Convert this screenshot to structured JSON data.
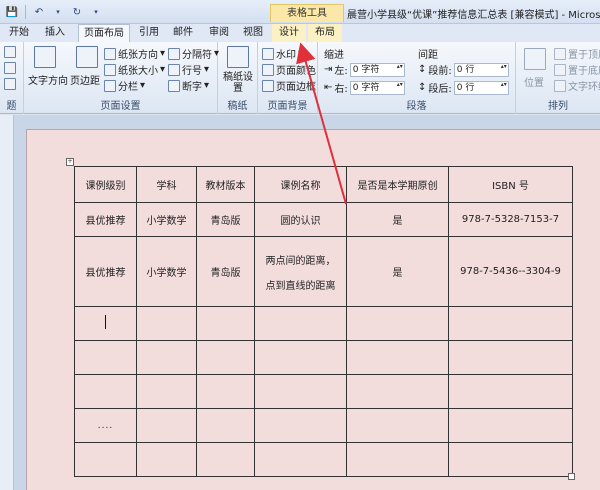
{
  "title_bar": {
    "context_tab_group": "表格工具",
    "document_title": "晨营小学县级“优课”推荐信息汇总表 [兼容模式] - Micros..."
  },
  "tabs": [
    {
      "label": "开始"
    },
    {
      "label": "插入"
    },
    {
      "label": "页面布局"
    },
    {
      "label": "引用"
    },
    {
      "label": "邮件"
    },
    {
      "label": "审阅"
    },
    {
      "label": "视图"
    },
    {
      "label": "设计"
    },
    {
      "label": "布局"
    }
  ],
  "ribbon": {
    "partial_group_label": "题",
    "page_setup": {
      "text_direction": "文字方向",
      "margins": "页边距",
      "orientation": "纸张方向",
      "size": "纸张大小",
      "columns": "分栏",
      "breaks": "分隔符",
      "line_numbers": "行号",
      "hyphenation": "断字",
      "label": "页面设置"
    },
    "manuscript": {
      "button": "稿纸设置",
      "label": "稿纸"
    },
    "page_background": {
      "watermark": "水印",
      "page_color": "页面颜色",
      "page_borders": "页面边框",
      "label": "页面背景"
    },
    "paragraph": {
      "indent_heading": "缩进",
      "spacing_heading": "间距",
      "left_label": "左:",
      "right_label": "右:",
      "left_value": "0 字符",
      "right_value": "0 字符",
      "before_label": "段前:",
      "after_label": "段后:",
      "before_value": "0 行",
      "after_value": "0 行",
      "label": "段落"
    },
    "arrange": {
      "position": "位置",
      "bring_front": "置于顶层",
      "send_back": "置于底层",
      "wrap_text": "文字环绕",
      "label": "排列"
    }
  },
  "table": {
    "headers": [
      "课例级别",
      "学科",
      "教材版本",
      "课例名称",
      "是否是本学期原创",
      "ISBN 号"
    ],
    "rows": [
      [
        "县优推荐",
        "小学数学",
        "青岛版",
        "圆的认识",
        "是",
        "978-7-5328-7153-7"
      ],
      [
        "县优推荐",
        "小学数学",
        "青岛版",
        "两点间的距离，|点到直线的距离",
        "是",
        "978-7-5436--3304-9"
      ]
    ],
    "row2_name_line1": "两点间的距离，",
    "row2_name_line2": "点到直线的距离",
    "ellipsis": "....",
    "colors": {
      "page_bg": "#f2dcdc",
      "arrow": "#e0303a"
    }
  }
}
